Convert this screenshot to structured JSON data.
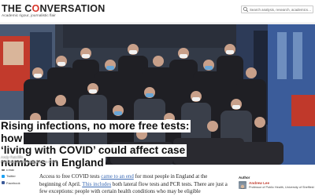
{
  "header": {
    "logo_prefix": "THE C",
    "logo_accent": "O",
    "logo_suffix": "NVERSATION",
    "tagline": "Academic rigour, journalistic flair",
    "search_placeholder": "Search analysis, research, academics…"
  },
  "article": {
    "headline_lines": [
      "Rising infections, no more free tests: how",
      "‘living with COVID’ could affect case",
      "numbers in England"
    ],
    "author": "Andy Ratcliffe",
    "date": "Published: April 8, 2022 8.27am CEST",
    "body_part1": "Access to free COVID tests ",
    "body_link1": "came to an end",
    "body_part2": " for most people in England at the beginning of April. ",
    "body_link2": "This includes",
    "body_part3": " both lateral flow tests and PCR tests. There are just a few exceptions: people with certain health conditions who may be eligible"
  },
  "social": {
    "items": [
      {
        "label": "Email",
        "color": "#777777"
      },
      {
        "label": "Twitter",
        "color": "#1da1f2"
      },
      {
        "label": "Facebook",
        "color": "#3b5998"
      }
    ]
  },
  "author_card": {
    "heading": "Author",
    "name": "Andrew Lee",
    "role": "Professor of Public Health, University of Sheffield"
  },
  "colors": {
    "brand_red": "#d8352a",
    "link_blue": "#3c6bb5"
  }
}
